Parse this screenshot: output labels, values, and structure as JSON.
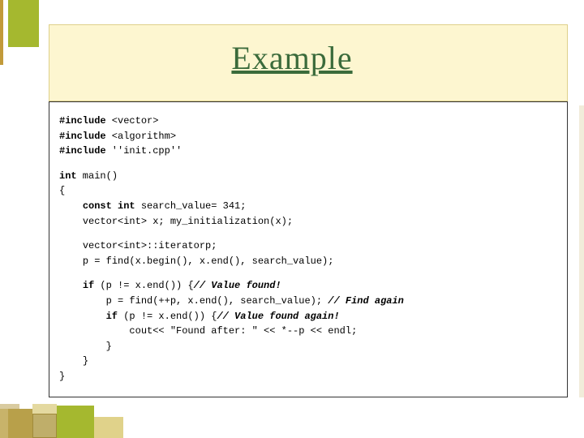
{
  "title": "Example",
  "code": {
    "include1_kw": "#include",
    "include1_rest": " <vector>",
    "include2_kw": "#include",
    "include2_rest": " <algorithm>",
    "include3_kw": "#include",
    "include3_rest": " ''init.cpp''",
    "main_sig_kw1": "int",
    "main_sig_rest": " main()",
    "brace_open": "{",
    "const_line_indent": "    ",
    "const_kw": "const int",
    "const_rest": " search_value= 341;",
    "vec_decl_indent": "    ",
    "vec_decl": "vector<int> x; my_initialization(x);",
    "iter_decl_indent": "    ",
    "iter_decl": "vector<int>::iteratorp;",
    "find1_indent": "    ",
    "find1": "p = find(x.begin(), x.end(), search_value);",
    "if1_indent": "    ",
    "if1_kw": "if",
    "if1_cond": " (p != x.end()) {",
    "if1_comment": "// Value found!",
    "find2_indent": "        ",
    "find2": "p = find(++p, x.end(), search_value); ",
    "find2_comment": "// Find again",
    "if2_indent": "        ",
    "if2_kw": "if",
    "if2_cond": " (p != x.end()) {",
    "if2_comment": "// Value found again!",
    "cout_indent": "            ",
    "cout_line": "cout<< \"Found after: \" << *--p << endl;",
    "close_brace3_indent": "        ",
    "close_brace3": "}",
    "close_brace2_indent": "    ",
    "close_brace2": "}",
    "close_brace1": "}"
  }
}
